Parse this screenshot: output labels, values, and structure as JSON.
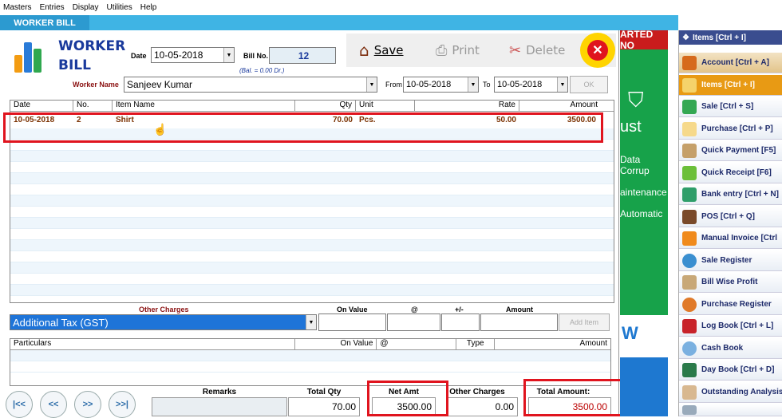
{
  "menu": [
    "Masters",
    "Entries",
    "Display",
    "Utilities",
    "Help"
  ],
  "tab": "WORKER BILL",
  "logo": {
    "line1": "WORKER",
    "line2": "BILL"
  },
  "header": {
    "date_label": "Date",
    "date": "10-05-2018",
    "billno_label": "Bill No.",
    "billno": "12",
    "balance": "(Bal. = 0.00 Dr.)",
    "worker_label": "Worker Name",
    "worker": "Sanjeev Kumar",
    "from_label": "From",
    "from": "10-05-2018",
    "to_label": "To",
    "to": "10-05-2018",
    "ok": "OK"
  },
  "toolbar": {
    "save": "Save",
    "print": "Print",
    "delete": "Delete"
  },
  "items_table": {
    "columns": [
      "Date",
      "No.",
      "Item Name",
      "Qty",
      "Unit",
      "Rate",
      "Amount"
    ],
    "rows": [
      {
        "date": "10-05-2018",
        "no": "2",
        "item": "Shirt",
        "qty": "70.00",
        "unit": "Pcs.",
        "rate": "50.00",
        "amount": "3500.00"
      }
    ]
  },
  "other_charges": {
    "label": "Other Charges",
    "on_value_label": "On Value",
    "at_label": "@",
    "plusminus_label": "+/-",
    "amount_label": "Amount",
    "selected": "Additional Tax (GST)",
    "add_item": "Add Item"
  },
  "particulars_table": {
    "columns": [
      "Particulars",
      "On Value",
      "@",
      "Type",
      "Amount"
    ]
  },
  "nav": [
    "|<<",
    "<<",
    ">>",
    ">>|"
  ],
  "summary": {
    "remarks_label": "Remarks",
    "total_qty_label": "Total Qty",
    "total_qty": "70.00",
    "net_amt_label": "Net Amt",
    "net_amt": "3500.00",
    "other_charges_label": "Other Charges",
    "other_charges": "0.00",
    "total_amount_label": "Total Amount:",
    "total_amount": "3500.00"
  },
  "ad": {
    "banner": "ARTED NO",
    "line1": "ust",
    "line2": "Data Corrup",
    "line3": "aintenance",
    "line4": "Automatic",
    "line5": "W"
  },
  "side": {
    "header": "Items [Ctrl + I]",
    "items": [
      "Account [Ctrl + A]",
      "Items [Ctrl + I]",
      "Sale [Ctrl + S]",
      "Purchase [Ctrl + P]",
      "Quick Payment [F5]",
      "Quick Receipt [F6]",
      "Bank entry [Ctrl + N]",
      "POS [Ctrl + Q]",
      "Manual Invoice [Ctrl",
      "Sale Register",
      "Bill Wise Profit",
      "Purchase Register",
      "Log Book [Ctrl + L]",
      "Cash Book",
      "Day Book [Ctrl + D]",
      "Outstanding Analysis"
    ]
  },
  "colors": {
    "tab": "#2c9ad0",
    "accent_red": "#e0141e",
    "green": "#17a24a"
  }
}
